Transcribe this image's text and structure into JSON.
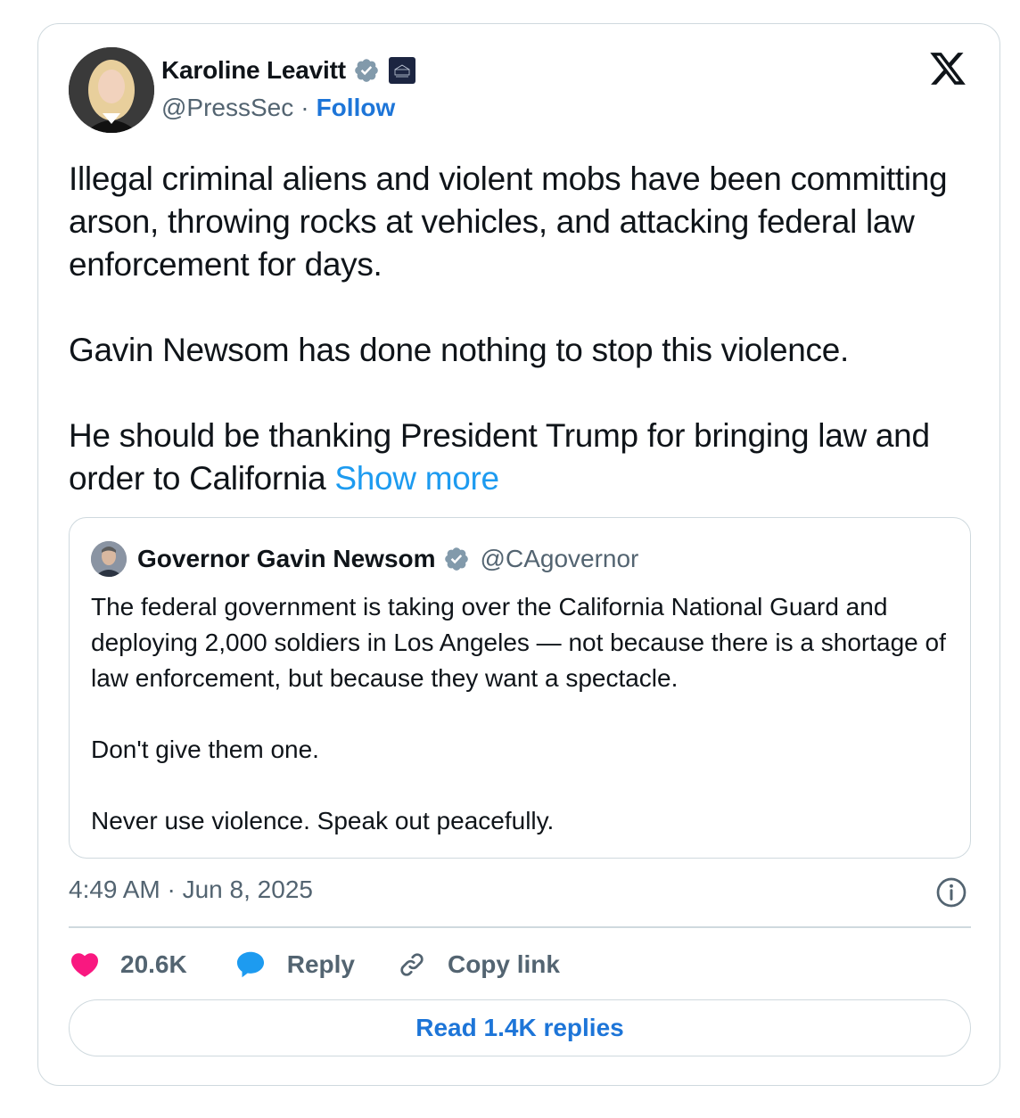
{
  "author": {
    "display_name": "Karoline Leavitt",
    "handle": "@PressSec",
    "separator": "·",
    "follow_label": "Follow",
    "verified_color": "#829aab",
    "affiliation": "The White House"
  },
  "tweet": {
    "paragraphs": [
      "Illegal criminal aliens and violent mobs have been committing arson, throwing rocks at vehicles, and attacking federal law enforcement for days.",
      "Gavin Newsom has done nothing to stop this violence.",
      "He should be thanking President Trump for bringing law and order to California"
    ],
    "show_more": "Show more"
  },
  "quote": {
    "display_name": "Governor Gavin Newsom",
    "handle": "@CAgovernor",
    "paragraphs": [
      "The federal government is taking over the California National Guard and deploying 2,000 soldiers in Los Angeles — not because there is a shortage of law enforcement, but because they want a spectacle.",
      "Don't give them one.",
      "Never use violence. Speak out peacefully."
    ]
  },
  "timestamp": "4:49 AM · Jun 8, 2025",
  "actions": {
    "like_count": "20.6K",
    "reply_label": "Reply",
    "copy_label": "Copy link"
  },
  "read_replies": "Read 1.4K replies",
  "colors": {
    "link": "#1d9bf0",
    "action_blue": "#1d75d8",
    "heart": "#f91880",
    "secondary_text": "#536471",
    "border": "#cfd9de"
  },
  "icons": [
    "verified-badge-icon",
    "white-house-icon",
    "x-logo-icon",
    "info-icon",
    "heart-icon",
    "reply-bubble-icon",
    "link-icon"
  ]
}
